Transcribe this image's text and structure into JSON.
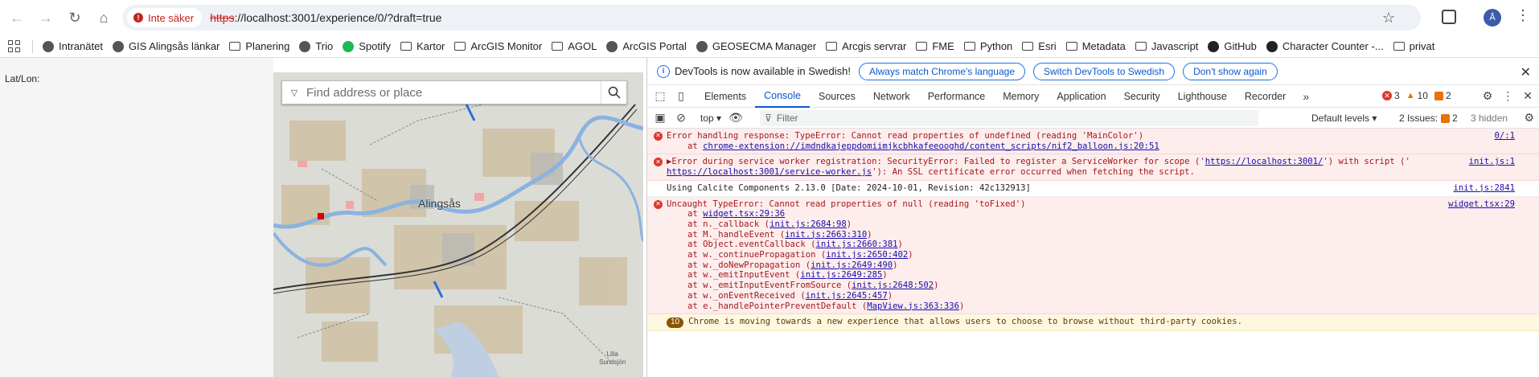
{
  "browser": {
    "security_label": "Inte säker",
    "url_protocol": "https",
    "url_rest": "://localhost:3001/experience/0/?draft=true",
    "avatar_letter": "Å"
  },
  "bookmarks": [
    {
      "label": "Intranätet",
      "icon": "person-icon"
    },
    {
      "label": "GIS Alingsås länkar",
      "icon": "globe-icon"
    },
    {
      "label": "Planering",
      "icon": "folder-icon"
    },
    {
      "label": "Trio",
      "icon": "globe-icon"
    },
    {
      "label": "Spotify",
      "icon": "spotify-icon"
    },
    {
      "label": "Kartor",
      "icon": "folder-icon"
    },
    {
      "label": "ArcGIS Monitor",
      "icon": "folder-icon"
    },
    {
      "label": "AGOL",
      "icon": "folder-icon"
    },
    {
      "label": "ArcGIS Portal",
      "icon": "globe-icon"
    },
    {
      "label": "GEOSECMA Manager",
      "icon": "google-icon"
    },
    {
      "label": "Arcgis servrar",
      "icon": "folder-icon"
    },
    {
      "label": "FME",
      "icon": "folder-icon"
    },
    {
      "label": "Python",
      "icon": "folder-icon"
    },
    {
      "label": "Esri",
      "icon": "folder-icon"
    },
    {
      "label": "Metadata",
      "icon": "folder-icon"
    },
    {
      "label": "Javascript",
      "icon": "folder-icon"
    },
    {
      "label": "GitHub",
      "icon": "github-icon"
    },
    {
      "label": "Character Counter -...",
      "icon": "w-icon"
    },
    {
      "label": "privat",
      "icon": "folder-icon"
    }
  ],
  "app": {
    "latlon_label": "Lat/Lon:",
    "search_placeholder": "Find address or place",
    "map_place_label": "Alingsås",
    "map_attribution": "Lilla\nSundsjön"
  },
  "devtools": {
    "info_text": "DevTools is now available in Swedish!",
    "info_buttons": [
      "Always match Chrome's language",
      "Switch DevTools to Swedish",
      "Don't show again"
    ],
    "tabs": [
      "Elements",
      "Console",
      "Sources",
      "Network",
      "Performance",
      "Memory",
      "Application",
      "Security",
      "Lighthouse",
      "Recorder"
    ],
    "active_tab": "Console",
    "error_count": "3",
    "warning_count": "10",
    "issue_count": "2",
    "context": "top",
    "filter_placeholder": "Filter",
    "levels_label": "Default levels",
    "issues_label": "2 Issues:",
    "issues_count": "2",
    "hidden_label": "3 hidden"
  },
  "console": {
    "messages": [
      {
        "type": "error",
        "lines": [
          "Error handling response: TypeError: Cannot read properties of undefined (reading 'MainColor')",
          "    at chrome-extension://imdndkajeppdomiimjkcbhkafeeooghd/content_scripts/nif2_balloon.js:20:51"
        ],
        "source": "0/:1"
      },
      {
        "type": "error",
        "lines": [
          "▶Error during service worker registration: SecurityError: Failed to register a ServiceWorker for scope ('https://localhost:3001/') with script ('",
          "https://localhost:3001/service-worker.js'): An SSL certificate error occurred when fetching the script."
        ],
        "source": "init.js:1"
      },
      {
        "type": "plain",
        "lines": [
          "Using Calcite Components 2.13.0 [Date: 2024-10-01, Revision: 42c132913]"
        ],
        "source": "init.js:2841"
      },
      {
        "type": "error",
        "lines": [
          "Uncaught TypeError: Cannot read properties of null (reading 'toFixed')",
          "    at widget.tsx:29:36",
          "    at n._callback (init.js:2684:98)",
          "    at M._handleEvent (init.js:2663:310)",
          "    at Object.eventCallback (init.js:2660:381)",
          "    at w._continuePropagation (init.js:2650:402)",
          "    at w._doNewPropagation (init.js:2649:490)",
          "    at w._emitInputEvent (init.js:2649:285)",
          "    at w._emitInputEventFromSource (init.js:2648:502)",
          "    at w._onEventReceived (init.js:2645:457)",
          "    at e._handlePointerPreventDefault (MapView.js:363:336)"
        ],
        "source": "widget.tsx:29"
      },
      {
        "type": "warn",
        "badge": "10",
        "lines": [
          "Chrome is moving towards a new experience that allows users to choose to browse without third-party cookies."
        ],
        "source": ""
      }
    ]
  }
}
